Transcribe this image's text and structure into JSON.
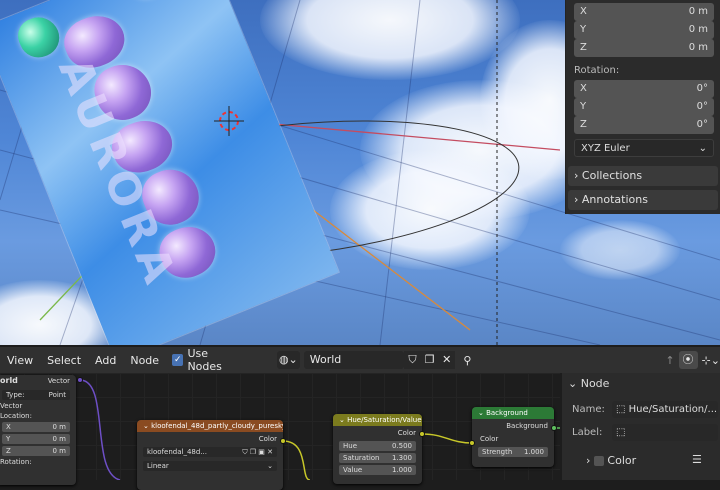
{
  "sidebar": {
    "location": {
      "x": {
        "label": "X",
        "value": "0 m"
      },
      "y": {
        "label": "Y",
        "value": "0 m"
      },
      "z": {
        "label": "Z",
        "value": "0 m"
      }
    },
    "rotation_label": "Rotation:",
    "rotation": {
      "x": {
        "label": "X",
        "value": "0°"
      },
      "y": {
        "label": "Y",
        "value": "0°"
      },
      "z": {
        "label": "Z",
        "value": "0°"
      }
    },
    "rotation_mode": "XYZ Euler",
    "collections": "Collections",
    "annotations": "Annotations"
  },
  "viewport_text": "AURORA",
  "node_editor": {
    "menu": [
      "View",
      "Select",
      "Add",
      "Node"
    ],
    "use_nodes_label": "Use Nodes",
    "world_name": "World",
    "left_node": {
      "title": "orld",
      "type_label": "Type:",
      "type_value": "Point",
      "vector_label": "Vector",
      "output_label": "Vector",
      "location_label": "Location:",
      "loc": [
        {
          "axis": "X",
          "value": "0 m"
        },
        {
          "axis": "Y",
          "value": "0 m"
        },
        {
          "axis": "Z",
          "value": "0 m"
        }
      ],
      "rotation_label": "Rotation:"
    },
    "image_node": {
      "title": "kloofendal_48d_partly_cloudy_puresky_...",
      "output": "Color",
      "image_name": "kloofendal_48d...",
      "interpolation": "Linear"
    },
    "hsv_node": {
      "title": "Hue/Saturation/Value",
      "output": "Color",
      "fields": [
        {
          "label": "Hue",
          "value": "0.500"
        },
        {
          "label": "Saturation",
          "value": "1.300"
        },
        {
          "label": "Value",
          "value": "1.000"
        }
      ]
    },
    "bg_node": {
      "title": "Background",
      "output": "Background",
      "color_label": "Color",
      "strength_label": "Strength",
      "strength_value": "1.000"
    }
  },
  "node_panel": {
    "section": "Node",
    "name_label": "Name:",
    "name_value": "Hue/Saturation/...",
    "label_label": "Label:",
    "color_section": "Color"
  }
}
